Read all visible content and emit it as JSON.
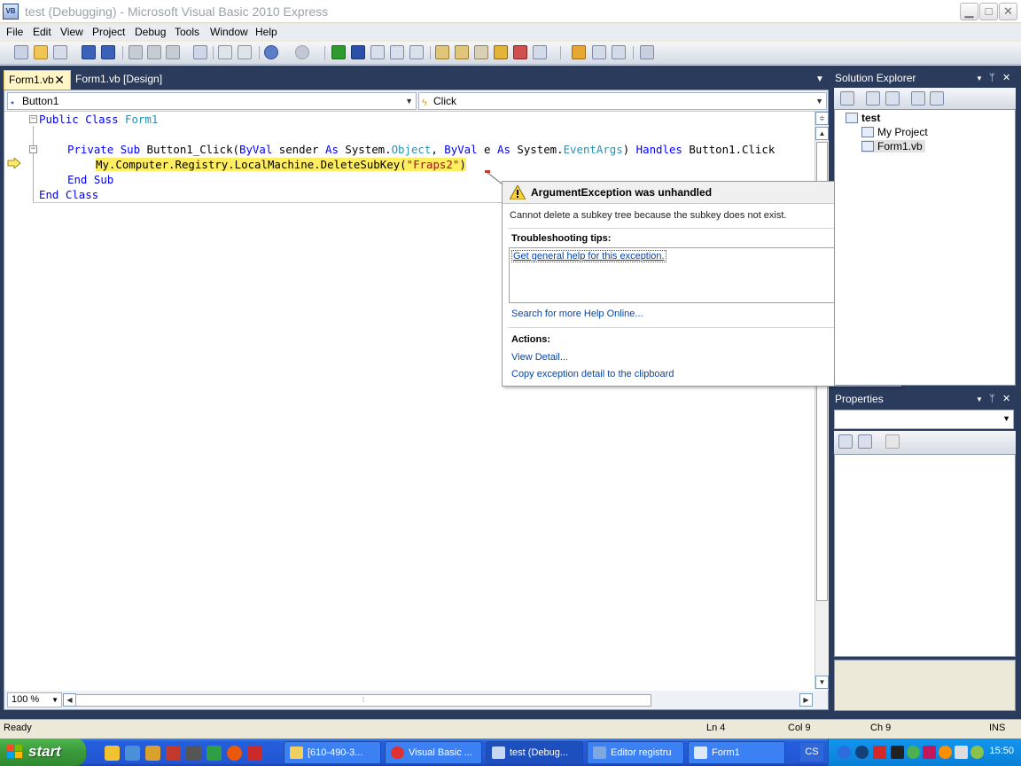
{
  "window": {
    "title": "test (Debugging) - Microsoft Visual Basic 2010 Express",
    "app_icon": "VB",
    "controls": {
      "minimize": "▁",
      "maximize": "□",
      "close": "✕"
    }
  },
  "menu": [
    "File",
    "Edit",
    "View",
    "Project",
    "Debug",
    "Tools",
    "Window",
    "Help"
  ],
  "tabs": {
    "active": "Form1.vb",
    "inactive": "Form1.vb [Design]"
  },
  "navbar": {
    "object": "Button1",
    "event": "Click"
  },
  "code": {
    "line1": {
      "kw1": "Public",
      "kw2": "Class",
      "name": "Form1"
    },
    "line3": {
      "kw1": "Private",
      "kw2": "Sub",
      "name": "Button1_Click(",
      "byval1": "ByVal",
      "p1": " sender ",
      "as1": "As",
      "sys1": " System.",
      "t1": "Object",
      "comma": ", ",
      "byval2": "ByVal",
      "p2": " e ",
      "as2": "As",
      "sys2": " System.",
      "t2": "EventArgs",
      "close": ") ",
      "handles": "Handles",
      "tail": " Button1.Click"
    },
    "line4": {
      "prefix": "My.Computer.Registry.LocalMachine.DeleteSubKey(",
      "str": "\"Fraps2\"",
      "suffix": ")"
    },
    "line5": {
      "kw1": "End",
      "kw2": "Sub"
    },
    "line6": {
      "kw1": "End",
      "kw2": "Class"
    },
    "expander": "−"
  },
  "zoom": "100 %",
  "exception": {
    "title": "ArgumentException was unhandled",
    "message": "Cannot delete a subkey tree because the subkey does not exist.",
    "tips_heading": "Troubleshooting tips:",
    "tip_link": "Get general help for this exception.",
    "search_link": "Search for more Help Online...",
    "actions_heading": "Actions:",
    "view_detail": "View Detail...",
    "copy_detail": "Copy exception detail to the clipboard",
    "close": "✕"
  },
  "solution_explorer": {
    "title": "Solution Explorer",
    "project": "test",
    "items": [
      "My Project",
      "Form1.vb"
    ]
  },
  "properties": {
    "title": "Properties"
  },
  "panel_controls": {
    "menu": "▼",
    "pin": "ᛘ",
    "close": "✕"
  },
  "status": {
    "ready": "Ready",
    "ln": "Ln 4",
    "col": "Col 9",
    "ch": "Ch 9",
    "mode": "INS"
  },
  "taskbar": {
    "start": "start",
    "tasks": [
      "[610-490-3...",
      "Visual Basic ...",
      "test (Debug...",
      "Editor registru",
      "Form1"
    ],
    "lang": "CS",
    "clock": "15:50"
  },
  "colors": {
    "keyword": "#0000ff",
    "type": "#2b91af",
    "string": "#a31515",
    "highlight": "#ffee62",
    "workspace": "#2b3b5b"
  }
}
